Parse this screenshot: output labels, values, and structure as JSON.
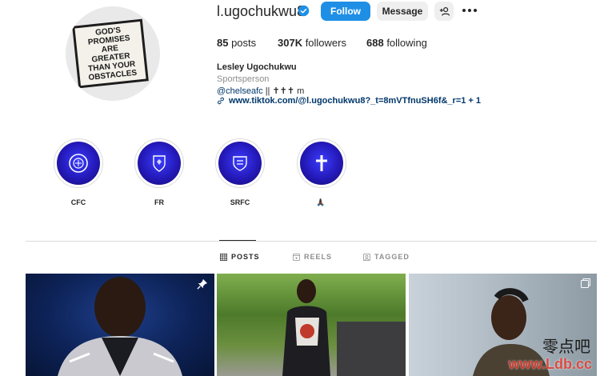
{
  "profile": {
    "username": "l.ugochukwu8",
    "verified_icon": "verified-badge-icon",
    "avatar_text": "GOD'S PROMISES ARE GREATER THAN YOUR OBSTACLES",
    "buttons": {
      "follow": "Follow",
      "message": "Message",
      "suggest_icon": "+👤",
      "more_icon": "ellipsis-icon"
    },
    "stats": {
      "posts_count": "85",
      "posts_label": " posts",
      "followers_count": "307K",
      "followers_label": " followers",
      "following_count": "688",
      "following_label": " following"
    },
    "bio": {
      "full_name": "Lesley Ugochukwu",
      "category": "Sportsperson",
      "mention": "@chelseafc",
      "line_rest": " || ✝✝✝ m",
      "link_icon": "🔗",
      "link": "www.tiktok.com/@l.ugochukwu8?_t=8mVTfnuSH6f&_r=1 + 1"
    }
  },
  "highlights": [
    {
      "label": "CFC",
      "icon": "chelsea-crest-icon"
    },
    {
      "label": "FR",
      "icon": "france-crest-icon"
    },
    {
      "label": "SRFC",
      "icon": "rennes-crest-icon"
    },
    {
      "label": "🙏🏿",
      "icon": "cross-icon"
    }
  ],
  "tabs": [
    {
      "label": "POSTS",
      "icon": "grid-icon",
      "active": true
    },
    {
      "label": "REELS",
      "icon": "reels-icon",
      "active": false
    },
    {
      "label": "TAGGED",
      "icon": "tagged-icon",
      "active": false
    }
  ],
  "posts": [
    {
      "name": "post-1",
      "badge": "pin-icon"
    },
    {
      "name": "post-2",
      "badge": ""
    },
    {
      "name": "post-3",
      "badge": "carousel-icon"
    }
  ],
  "watermark": {
    "text": "www.Ldb.cc",
    "chars": "零点吧"
  },
  "colors": {
    "accent": "#1f8fe6",
    "link": "#00376b",
    "muted": "#8e8e8e"
  }
}
